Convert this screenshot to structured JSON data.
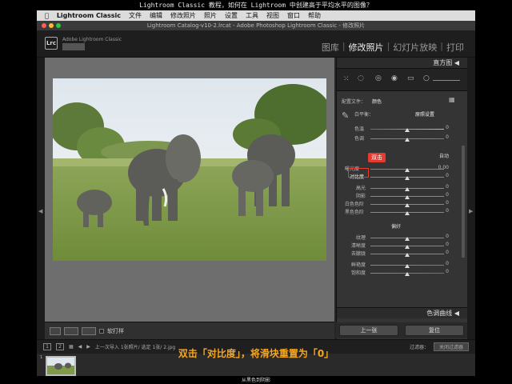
{
  "caption_top": "Lightroom Classic 教程，如何在 Lightroom 中创建高于平均水平的图像？",
  "menu": {
    "app": "Lightroom Classic",
    "items": [
      "文件",
      "编辑",
      "修改照片",
      "照片",
      "设置",
      "工具",
      "视图",
      "窗口",
      "帮助"
    ]
  },
  "window_title": "Lightroom Catalog-v10-2.lrcat - Adobe Photoshop Lightroom Classic - 修改照片",
  "identity": {
    "badge": "Lrc",
    "name": "Adobe Lightroom Classic"
  },
  "modules": [
    "图库",
    "修改照片",
    "幻灯片放映",
    "打印"
  ],
  "active_module": "修改照片",
  "right_panel": {
    "histogram_label": "直方图",
    "profile_label": "配置文件：",
    "profile_value": "颜色",
    "wb_label": "白平衡：",
    "wb_value": "原照设置",
    "temp_label": "色温",
    "tint_label": "色调",
    "tone_auto": "自动",
    "callout_text": "双击",
    "sliders": [
      {
        "label": "曝光度",
        "value": "0.00"
      },
      {
        "label": "对比度",
        "value": "0"
      },
      {
        "label": "高光",
        "value": "0"
      },
      {
        "label": "阴影",
        "value": "0"
      },
      {
        "label": "白色色阶",
        "value": "0"
      },
      {
        "label": "黑色色阶",
        "value": "0"
      }
    ],
    "presence_label": "偏好",
    "presence_sliders": [
      {
        "label": "纹理",
        "value": "0"
      },
      {
        "label": "清晰度",
        "value": "0"
      },
      {
        "label": "去朦胧",
        "value": "0"
      },
      {
        "label": "鲜艳度",
        "value": "0"
      },
      {
        "label": "饱和度",
        "value": "0"
      }
    ],
    "temp_value": "0",
    "tint_value": "0",
    "curve_label": "色调曲线",
    "prev_button": "上一张",
    "reset_button": "复位"
  },
  "toolbar": {
    "softproof": "软打样"
  },
  "strip": {
    "page1": "1",
    "page2": "2",
    "info": "上一次导入   1张照片/ 选定 1张/ 2.jpg",
    "filter_label": "过滤器：",
    "filter_value": "关闭过滤器"
  },
  "thumb_index": "1",
  "caption_bottom": "双击「对比度」，将滑块重置为「0」",
  "footer_text": "从黑色到阴影"
}
